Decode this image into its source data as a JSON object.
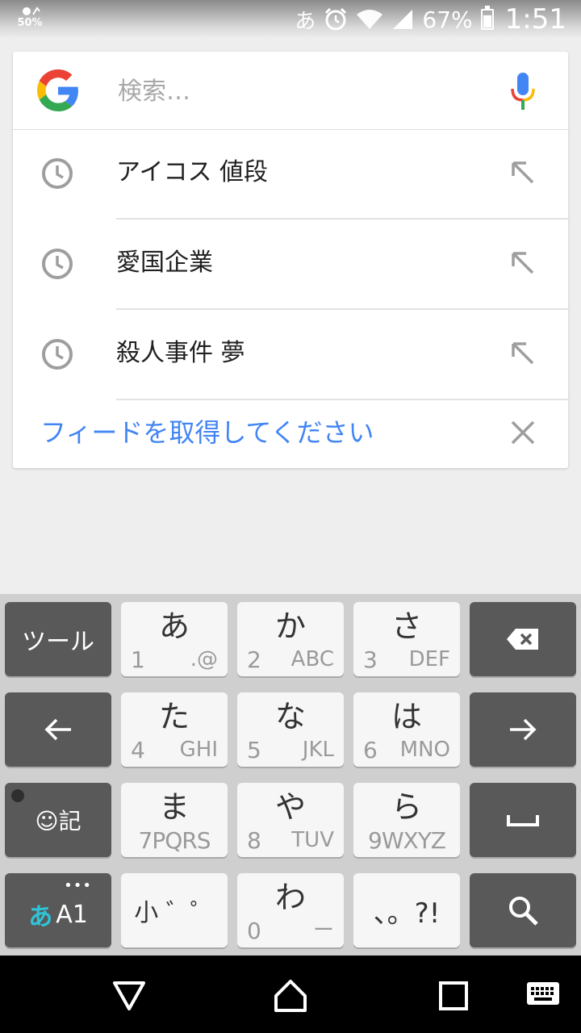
{
  "status_bar": {
    "left_badge": "50%",
    "ime_indicator": "あ",
    "battery_percent": "67%",
    "battery_level": 0.67,
    "time": "1:51"
  },
  "search": {
    "placeholder": "検索…",
    "value": "",
    "logo_icon": "google-g-icon",
    "mic_icon": "mic-icon"
  },
  "history": [
    {
      "label": "アイコス 値段"
    },
    {
      "label": "愛国企業"
    },
    {
      "label": "殺人事件 夢"
    }
  ],
  "feed": {
    "label": "フィードを取得してください"
  },
  "keyboard": {
    "tool": "ツール",
    "a": {
      "main": "あ",
      "num": "1",
      "sub": ".@"
    },
    "ka": {
      "main": "か",
      "num": "2",
      "sub": "ABC"
    },
    "sa": {
      "main": "さ",
      "num": "3",
      "sub": "DEF"
    },
    "ta": {
      "main": "た",
      "num": "4",
      "sub": "GHI"
    },
    "na": {
      "main": "な",
      "num": "5",
      "sub": "JKL"
    },
    "ha": {
      "main": "は",
      "num": "6",
      "sub": "MNO"
    },
    "ma": {
      "main": "ま",
      "sub": "7PQRS"
    },
    "ya": {
      "main": "や",
      "num": "8",
      "sub": "TUV"
    },
    "ra": {
      "main": "ら",
      "sub": "9WXYZ"
    },
    "emoji_label": "☺記",
    "mode_kana": "あ",
    "mode_alpha": "A1",
    "mode_more": "•••",
    "small_label": "小 ゛゜",
    "wa": {
      "main": "わ",
      "num": "0",
      "sub": "ー"
    },
    "punct": "、。?!"
  },
  "colors": {
    "accent_blue": "#4285f4",
    "dark_key": "#595959",
    "light_key": "#f6f6f6",
    "kana_mode_cyan": "#2ec4d6"
  }
}
